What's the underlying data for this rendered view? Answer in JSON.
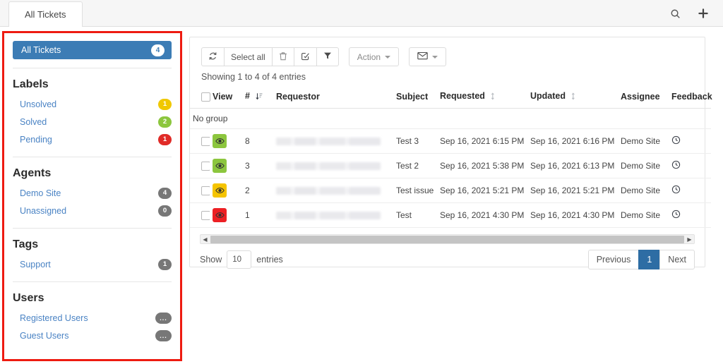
{
  "window": {
    "tab_label": "All Tickets",
    "search_icon": "search-icon",
    "add_icon": "plus-icon"
  },
  "sidebar": {
    "active_item": {
      "label": "All Tickets",
      "count": "4"
    },
    "sections": [
      {
        "heading": "Labels",
        "items": [
          {
            "label": "Unsolved",
            "count": "1",
            "color": "#f0c800"
          },
          {
            "label": "Solved",
            "count": "2",
            "color": "#8cc63e"
          },
          {
            "label": "Pending",
            "count": "1",
            "color": "#e02b27"
          }
        ]
      },
      {
        "heading": "Agents",
        "items": [
          {
            "label": "Demo Site",
            "count": "4",
            "color": "#777777"
          },
          {
            "label": "Unassigned",
            "count": "0",
            "color": "#777777"
          }
        ]
      },
      {
        "heading": "Tags",
        "items": [
          {
            "label": "Support",
            "count": "1",
            "color": "#777777"
          }
        ]
      },
      {
        "heading": "Users",
        "items": [
          {
            "label": "Registered Users",
            "count": "...",
            "color": "#777777"
          },
          {
            "label": "Guest Users",
            "count": "...",
            "color": "#777777"
          }
        ]
      }
    ]
  },
  "toolbar": {
    "refresh_icon": "refresh-icon",
    "select_all_label": "Select all",
    "delete_icon": "trash-icon",
    "edit_icon": "edit-check-icon",
    "filter_icon": "filter-funnel-icon",
    "action_label": "Action",
    "mail_icon": "envelope-icon"
  },
  "table": {
    "showing_text": "Showing 1 to 4 of 4 entries",
    "group_label": "No group",
    "headers": {
      "view": "View",
      "num": "#",
      "requestor": "Requestor",
      "subject": "Subject",
      "requested": "Requested",
      "updated": "Updated",
      "assignee": "Assignee",
      "feedback": "Feedback"
    },
    "rows": [
      {
        "id": "8",
        "status_color": "#8cc63e",
        "subject": "Test 3",
        "requested": "Sep 16, 2021 6:15 PM",
        "updated": "Sep 16, 2021 6:16 PM",
        "assignee": "Demo Site"
      },
      {
        "id": "3",
        "status_color": "#8cc63e",
        "subject": "Test 2",
        "requested": "Sep 16, 2021 5:38 PM",
        "updated": "Sep 16, 2021 6:13 PM",
        "assignee": "Demo Site"
      },
      {
        "id": "2",
        "status_color": "#f5c400",
        "subject": "Test issue",
        "requested": "Sep 16, 2021 5:21 PM",
        "updated": "Sep 16, 2021 5:21 PM",
        "assignee": "Demo Site"
      },
      {
        "id": "1",
        "status_color": "#ed2024",
        "subject": "Test",
        "requested": "Sep 16, 2021 4:30 PM",
        "updated": "Sep 16, 2021 4:30 PM",
        "assignee": "Demo Site"
      }
    ]
  },
  "footer": {
    "show_label": "Show",
    "entries_value": "10",
    "entries_label": "entries",
    "previous_label": "Previous",
    "page_label": "1",
    "next_label": "Next"
  },
  "colors": {
    "accent_blue": "#3c7cb5",
    "page_active_blue": "#2e6da4",
    "annotation_red": "#ee1b11",
    "link_blue": "#4a83c4"
  }
}
